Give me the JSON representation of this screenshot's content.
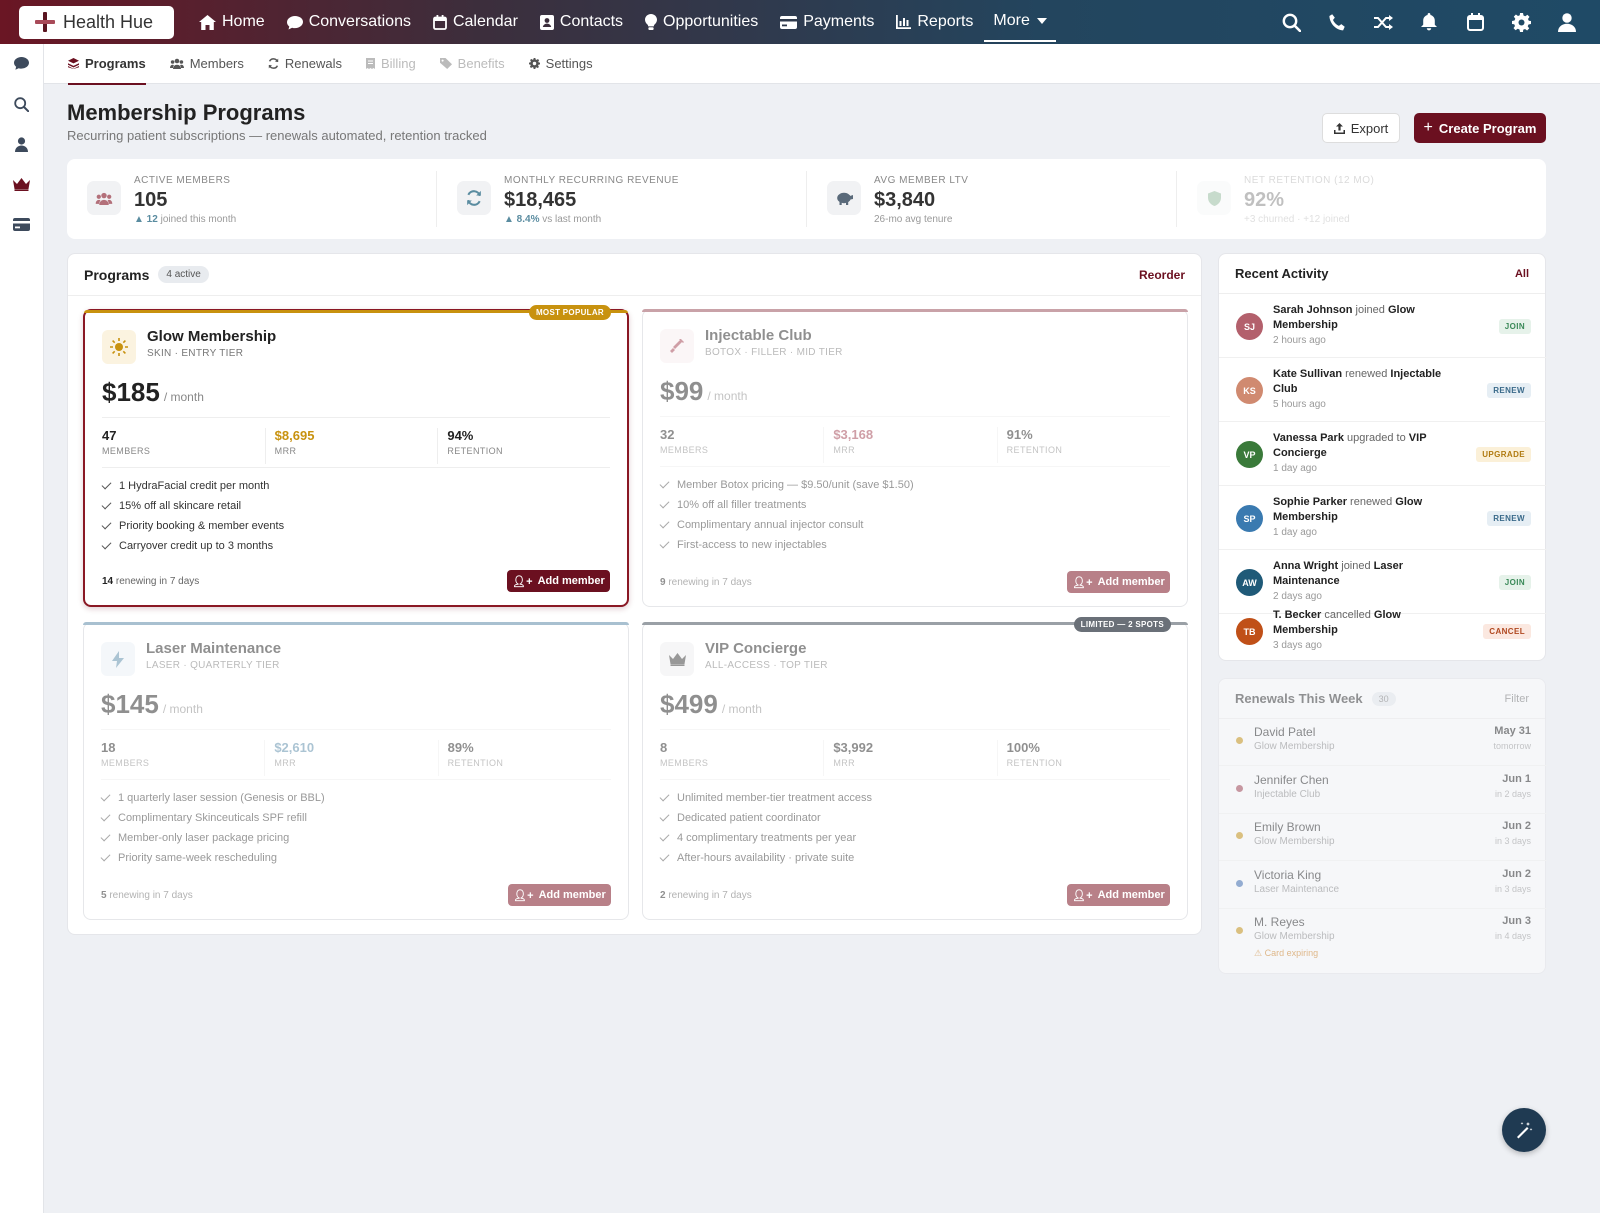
{
  "brand": {
    "name": "Health Hue"
  },
  "nav": {
    "home": "Home",
    "conversations": "Conversations",
    "calendar": "Calendar",
    "contacts": "Contacts",
    "opportunities": "Opportunities",
    "payments": "Payments",
    "reports": "Reports",
    "more": "More"
  },
  "subnav": {
    "programs": "Programs",
    "members": "Members",
    "renewals": "Renewals",
    "billing": "Billing",
    "benefits": "Benefits",
    "settings": "Settings"
  },
  "page": {
    "title": "Membership Programs",
    "subtitle": "Recurring patient subscriptions — renewals automated, retention tracked",
    "export_label": "Export",
    "create_label": "Create Program"
  },
  "kpis": [
    {
      "label": "ACTIVE MEMBERS",
      "value": "105",
      "delta": "▲ 12",
      "sub": " joined this month"
    },
    {
      "label": "MONTHLY RECURRING REVENUE",
      "value": "$18,465",
      "delta": "▲ 8.4%",
      "sub": " vs last month"
    },
    {
      "label": "AVG MEMBER LTV",
      "value": "$3,840",
      "delta": "",
      "sub": "26-mo avg tenure"
    },
    {
      "label": "NET RETENTION (12 MO)",
      "value": "92%",
      "delta": "",
      "sub": "+3 churned · +12 joined"
    }
  ],
  "programs_panel": {
    "title": "Programs",
    "badge": "4 active",
    "reorder": "Reorder"
  },
  "programs": [
    {
      "name": "Glow Membership",
      "tier": "SKIN · ENTRY TIER",
      "price": "$185",
      "per": "/ month",
      "ribbon": "MOST POPULAR",
      "stats": [
        {
          "v": "47",
          "l": "MEMBERS"
        },
        {
          "v": "$8,695",
          "l": "MRR"
        },
        {
          "v": "94%",
          "l": "RETENTION"
        }
      ],
      "features": [
        "1 HydraFacial credit per month",
        "15% off all skincare retail",
        "Priority booking & member events",
        "Carryover credit up to 3 months"
      ],
      "renew_count": "14",
      "renew_text": " renewing in 7 days",
      "add_label": "Add member",
      "accent": "#c8920f"
    },
    {
      "name": "Injectable Club",
      "tier": "BOTOX · FILLER · MID TIER",
      "price": "$99",
      "per": "/ month",
      "ribbon": "",
      "stats": [
        {
          "v": "32",
          "l": "MEMBERS"
        },
        {
          "v": "$3,168",
          "l": "MRR"
        },
        {
          "v": "91%",
          "l": "RETENTION"
        }
      ],
      "features": [
        "Member Botox pricing — $9.50/unit (save $1.50)",
        "10% off all filler treatments",
        "Complimentary annual injector consult",
        "First-access to new injectables"
      ],
      "renew_count": "9",
      "renew_text": " renewing in 7 days",
      "add_label": "Add member",
      "accent": "#b3707a"
    },
    {
      "name": "Laser Maintenance",
      "tier": "LASER · QUARTERLY TIER",
      "price": "$145",
      "per": "/ month",
      "ribbon": "",
      "stats": [
        {
          "v": "18",
          "l": "MEMBERS"
        },
        {
          "v": "$2,610",
          "l": "MRR"
        },
        {
          "v": "89%",
          "l": "RETENTION"
        }
      ],
      "features": [
        "1 quarterly laser session (Genesis or BBL)",
        "Complimentary Skinceuticals SPF refill",
        "Member-only laser package pricing",
        "Priority same-week rescheduling"
      ],
      "renew_count": "5",
      "renew_text": " renewing in 7 days",
      "add_label": "Add member",
      "accent": "#5a8aa8"
    },
    {
      "name": "VIP Concierge",
      "tier": "ALL-ACCESS · TOP TIER",
      "price": "$499",
      "per": "/ month",
      "ribbon": "LIMITED — 2 SPOTS",
      "stats": [
        {
          "v": "8",
          "l": "MEMBERS"
        },
        {
          "v": "$3,992",
          "l": "MRR"
        },
        {
          "v": "100%",
          "l": "RETENTION"
        }
      ],
      "features": [
        "Unlimited member-tier treatment access",
        "Dedicated patient coordinator",
        "4 complimentary treatments per year",
        "After-hours availability · private suite"
      ],
      "renew_count": "2",
      "renew_text": " renewing in 7 days",
      "add_label": "Add member",
      "accent": "#555a60"
    }
  ],
  "activity": {
    "title": "Recent Activity",
    "all": "All",
    "items": [
      {
        "initials": "SJ",
        "name": "Sarah Johnson",
        "verb": " joined ",
        "target": "Glow Membership",
        "time": "2 hours ago",
        "tag": "JOIN",
        "color": "#b3606c",
        "tagbg": "#e6f2ea",
        "tagfg": "#3a8a58"
      },
      {
        "initials": "KS",
        "name": "Kate Sullivan",
        "verb": " renewed ",
        "target": "Injectable Club",
        "time": "5 hours ago",
        "tag": "RENEW",
        "color": "#d08a70",
        "tagbg": "#e6eef4",
        "tagfg": "#3a6a8a"
      },
      {
        "initials": "VP",
        "name": "Vanessa Park",
        "verb": " upgraded to ",
        "target": "VIP Concierge",
        "time": "1 day ago",
        "tag": "UPGRADE",
        "color": "#3a7a3a",
        "tagbg": "#fbf0d8",
        "tagfg": "#b07a10"
      },
      {
        "initials": "SP",
        "name": "Sophie Parker",
        "verb": " renewed ",
        "target": "Glow Membership",
        "time": "1 day ago",
        "tag": "RENEW",
        "color": "#3a7ab0",
        "tagbg": "#e6eef4",
        "tagfg": "#3a6a8a"
      },
      {
        "initials": "AW",
        "name": "Anna Wright",
        "verb": " joined ",
        "target": "Laser Maintenance",
        "time": "2 days ago",
        "tag": "JOIN",
        "color": "#1f5a78",
        "tagbg": "#e6f2ea",
        "tagfg": "#3a8a58"
      },
      {
        "initials": "TB",
        "name": "T. Becker",
        "verb": " cancelled ",
        "target": "Glow Membership",
        "time": "3 days ago",
        "tag": "CANCEL",
        "color": "#c05018",
        "tagbg": "#fbe8e0",
        "tagfg": "#b04820"
      }
    ]
  },
  "renewals": {
    "title": "Renewals This Week",
    "count": "30",
    "filter": "Filter",
    "items": [
      {
        "name": "David Patel",
        "program": "Glow Membership",
        "date": "May 31",
        "rel": "tomorrow",
        "color": "#c8920f",
        "warn": ""
      },
      {
        "name": "Jennifer Chen",
        "program": "Injectable Club",
        "date": "Jun 1",
        "rel": "in 2 days",
        "color": "#a04050",
        "warn": ""
      },
      {
        "name": "Emily Brown",
        "program": "Glow Membership",
        "date": "Jun 2",
        "rel": "in 3 days",
        "color": "#c8920f",
        "warn": ""
      },
      {
        "name": "Victoria King",
        "program": "Laser Maintenance",
        "date": "Jun 2",
        "rel": "in 3 days",
        "color": "#3a6ab0",
        "warn": ""
      },
      {
        "name": "M. Reyes",
        "program": "Glow Membership",
        "date": "Jun 3",
        "rel": "in 4 days",
        "color": "#c8920f",
        "warn": "⚠ Card expiring"
      }
    ]
  }
}
